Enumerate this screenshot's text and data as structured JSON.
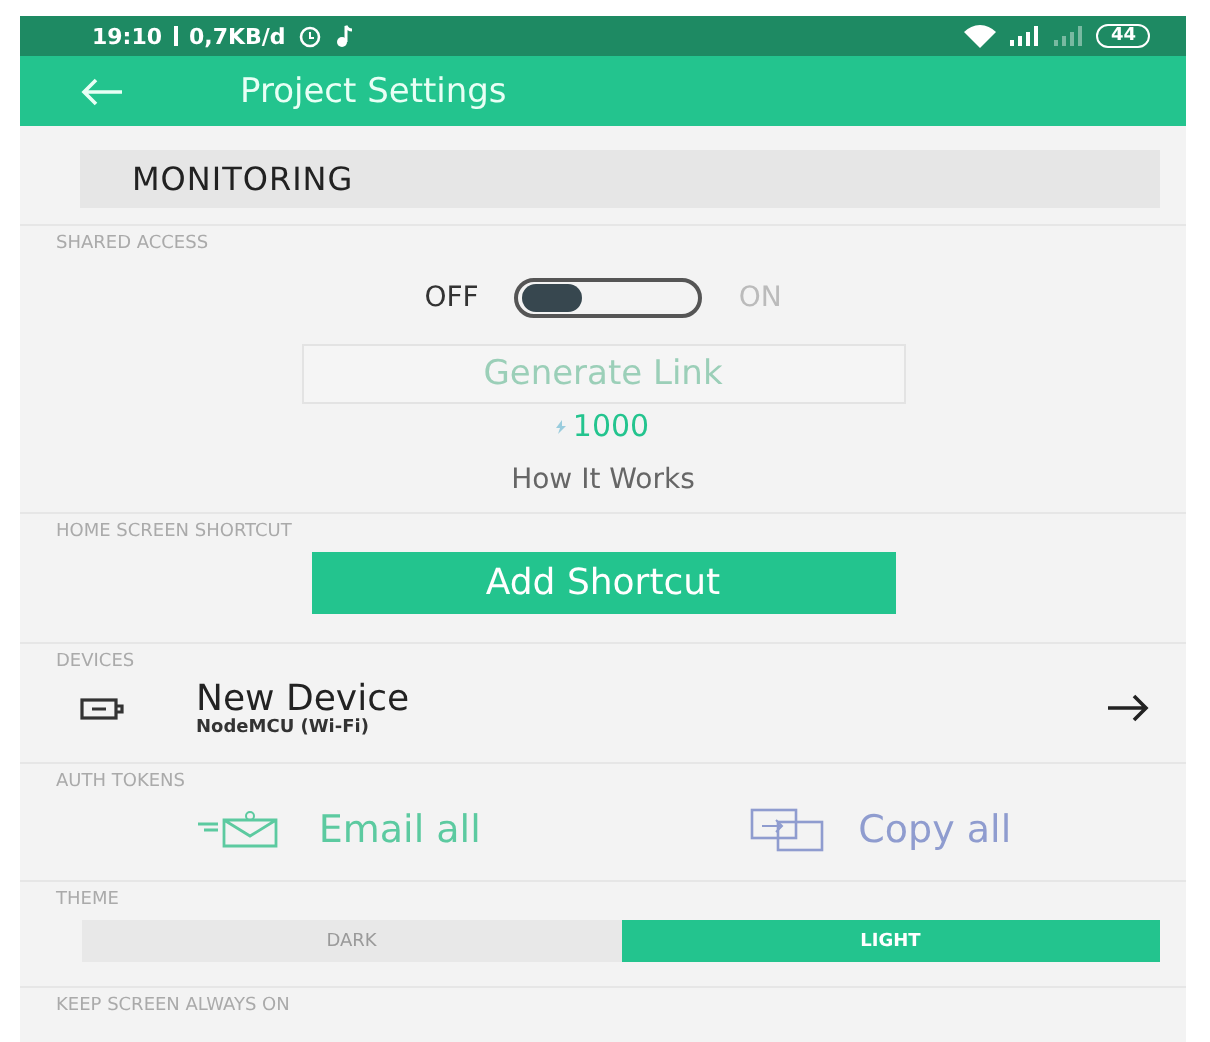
{
  "status_bar": {
    "time": "19:10",
    "speed": "0,7KB/d",
    "battery": "44"
  },
  "app_bar": {
    "title": "Project Settings"
  },
  "project_name": {
    "value": "MONITORING"
  },
  "shared_access": {
    "label": "SHARED ACCESS",
    "off_label": "OFF",
    "on_label": "ON",
    "on": false,
    "generate_button": "Generate Link",
    "energy": "1000",
    "how_link": "How It Works"
  },
  "home_shortcut": {
    "label": "HOME SCREEN SHORTCUT",
    "button": "Add Shortcut"
  },
  "devices": {
    "label": "DEVICES",
    "items": [
      {
        "name": "New Device",
        "model": "NodeMCU (Wi-Fi)"
      }
    ]
  },
  "auth_tokens": {
    "label": "AUTH TOKENS",
    "email_button": "Email all",
    "copy_button": "Copy all"
  },
  "theme": {
    "label": "THEME",
    "options": [
      {
        "label": "DARK",
        "selected": false
      },
      {
        "label": "LIGHT",
        "selected": true
      }
    ]
  },
  "keep_screen": {
    "label": "KEEP SCREEN ALWAYS ON"
  }
}
